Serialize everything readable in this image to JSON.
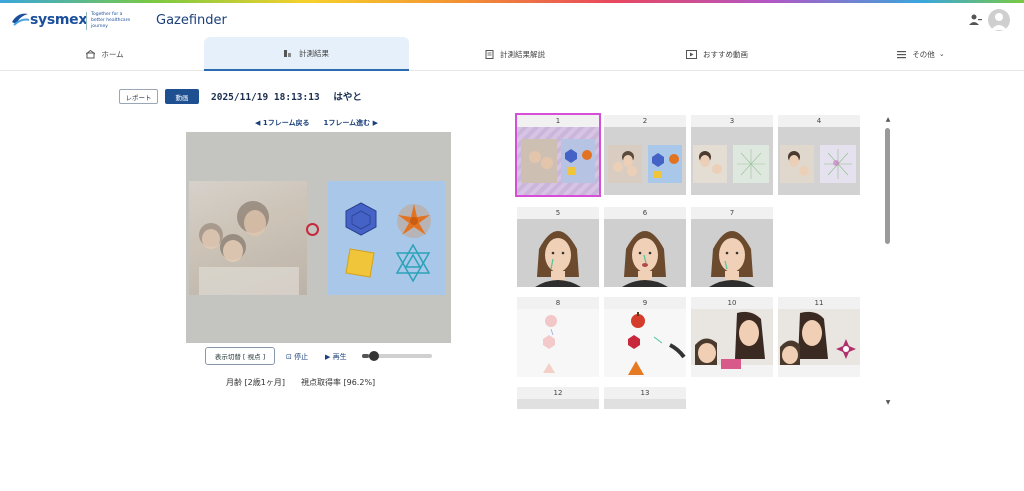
{
  "header": {
    "logo_text": "sysmex",
    "logo_tagline": "Together for a better healthcare journey",
    "app_title": "Gazefinder"
  },
  "nav": {
    "tabs": [
      {
        "label": "ホーム",
        "icon": "home-icon"
      },
      {
        "label": "計測結果",
        "icon": "chart-icon",
        "active": true
      },
      {
        "label": "計測結果解説",
        "icon": "book-icon"
      },
      {
        "label": "おすすめ動画",
        "icon": "video-icon"
      },
      {
        "label": "その他",
        "icon": "menu-icon"
      }
    ]
  },
  "toolbar": {
    "report_label": "レポート",
    "video_label": "動画",
    "date": "2025/11/19 18:13:13",
    "name": "はやと"
  },
  "frame_nav": {
    "prev_label": "◀ 1フレーム戻る",
    "next_label": "1フレーム進む ▶"
  },
  "controls": {
    "toggle_label": "表示切替 [ 視点 ]",
    "stop_label": "停止",
    "play_label": "再生",
    "progress": 0.1
  },
  "stats": {
    "age_text": "月齢 [2歳1ヶ月]",
    "rate_text": "視点取得率 [96.2%]"
  },
  "thumbnails": [
    {
      "num": "1"
    },
    {
      "num": "2"
    },
    {
      "num": "3"
    },
    {
      "num": "4"
    },
    {
      "num": "5"
    },
    {
      "num": "6"
    },
    {
      "num": "7"
    },
    {
      "num": "8"
    },
    {
      "num": "9"
    },
    {
      "num": "10"
    },
    {
      "num": "11"
    },
    {
      "num": "12"
    },
    {
      "num": "13"
    }
  ],
  "colors": {
    "accent": "#1e4f91",
    "selected_outline": "#d64fd9",
    "gaze_marker": "#c8283c"
  }
}
